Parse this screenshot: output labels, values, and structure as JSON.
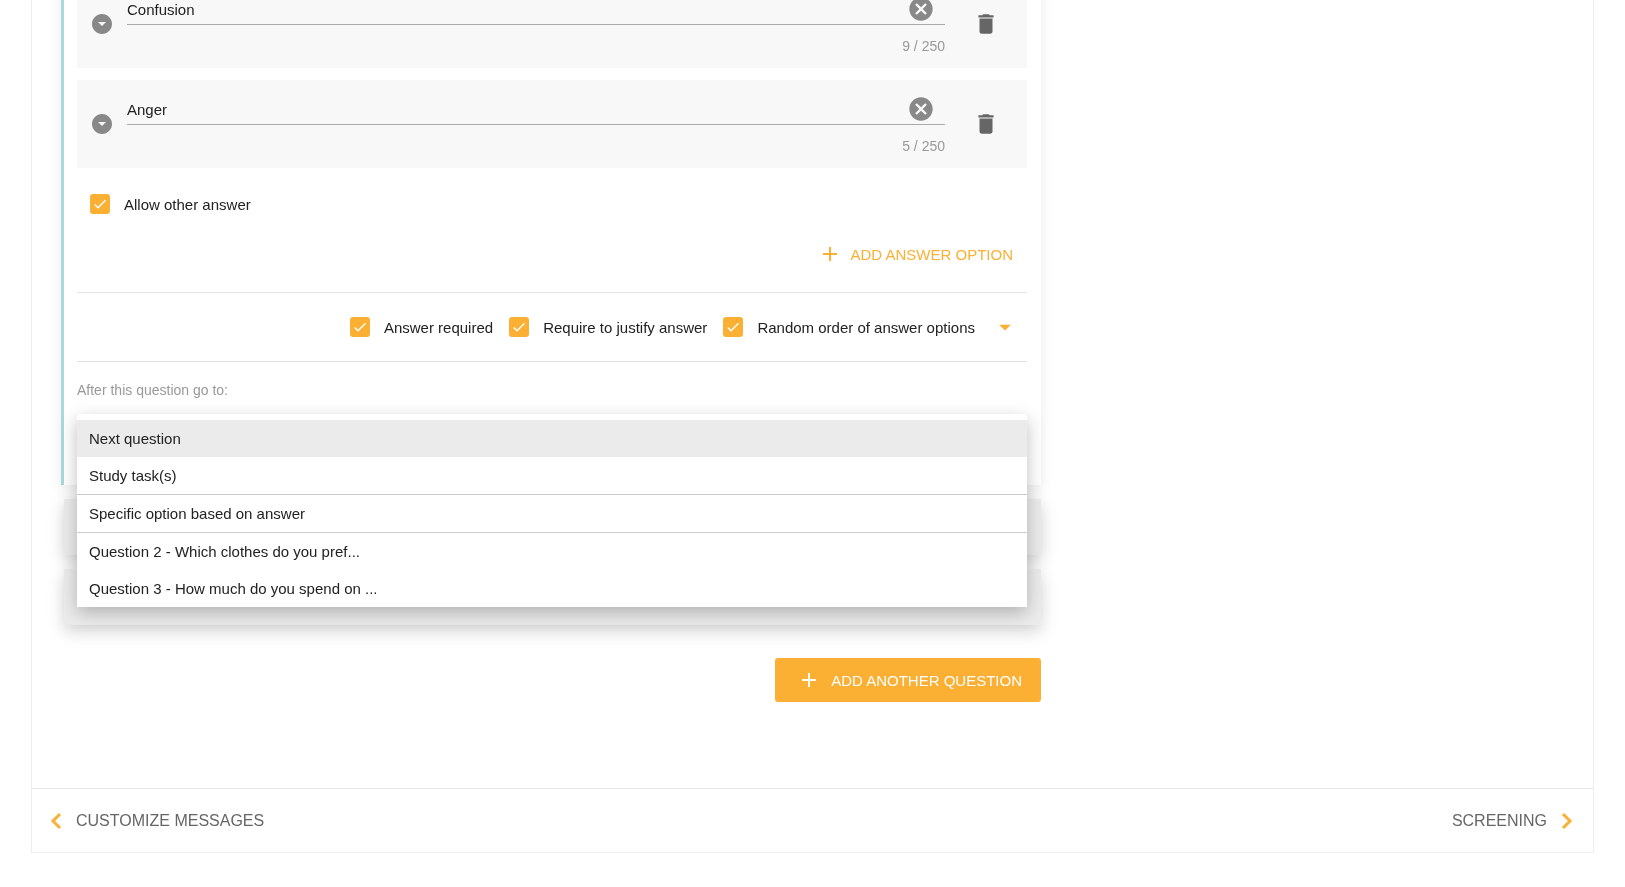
{
  "question_card": {
    "answer_options": [
      {
        "value": "Confusion",
        "counter": "9 / 250"
      },
      {
        "value": "Anger",
        "counter": "5 / 250"
      }
    ],
    "allow_other_answer": {
      "label": "Allow other answer",
      "checked": true
    },
    "add_answer_option": "ADD ANSWER OPTION",
    "settings": [
      {
        "label": "Answer required",
        "checked": true
      },
      {
        "label": "Require to justify answer",
        "checked": true
      },
      {
        "label": "Random order of answer options",
        "checked": true
      }
    ],
    "go_to_label": "After this question go to:"
  },
  "go_to_menu": {
    "sections": [
      {
        "items": [
          {
            "label": "Next question",
            "selected": true
          },
          {
            "label": "Study task(s)",
            "selected": false
          }
        ]
      },
      {
        "items": [
          {
            "label": "Specific option based on answer",
            "selected": false
          }
        ]
      },
      {
        "items": [
          {
            "label": "Question 2 - Which clothes do you pref...",
            "selected": false
          },
          {
            "label": "Question 3 - How much do you spend on ...",
            "selected": false
          }
        ]
      }
    ]
  },
  "collapsed_questions": [
    {
      "kind": "question"
    },
    {
      "kind": "question"
    }
  ],
  "add_question_button": "ADD ANOTHER QUESTION",
  "footer": {
    "back": "CUSTOMIZE MESSAGES",
    "next": "SCREENING"
  }
}
